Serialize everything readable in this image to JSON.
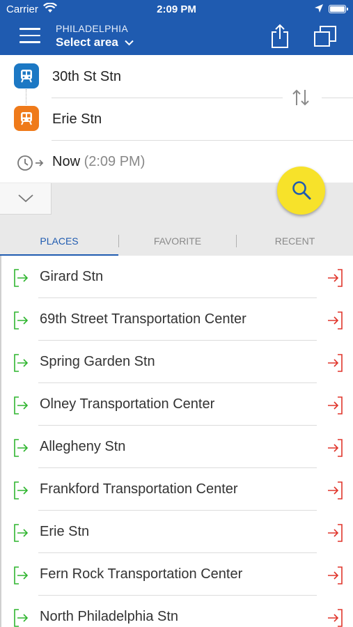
{
  "status_bar": {
    "carrier": "Carrier",
    "time": "2:09 PM"
  },
  "header": {
    "city": "PHILADELPHIA",
    "area_selector": "Select area"
  },
  "route": {
    "from": "30th St Stn",
    "to": "Erie Stn",
    "time_label": "Now",
    "time_value": "(2:09 PM)"
  },
  "tabs": [
    {
      "label": "PLACES",
      "active": true
    },
    {
      "label": "FAVORITE",
      "active": false
    },
    {
      "label": "RECENT",
      "active": false
    }
  ],
  "places": [
    "Girard Stn",
    "69th Street Transportation Center",
    "Spring Garden Stn",
    "Olney Transportation Center",
    "Allegheny Stn",
    "Frankford Transportation Center",
    "Erie Stn",
    "Fern Rock Transportation Center",
    "North Philadelphia Stn"
  ],
  "colors": {
    "header": "#1f5bb0",
    "from_station": "#1c78c4",
    "to_station": "#ef7a1a",
    "search_button": "#f7e22a",
    "set_origin_icon": "#2fb52f",
    "set_destination_icon": "#e0352b"
  },
  "icons": {
    "menu": "hamburger-icon",
    "share": "share-icon",
    "copy": "copy-icon",
    "swap": "swap-icon",
    "clock": "clock-icon",
    "search": "search-icon",
    "expand": "chevron-down-icon",
    "set_origin": "set-origin-icon",
    "set_destination": "set-destination-icon"
  }
}
